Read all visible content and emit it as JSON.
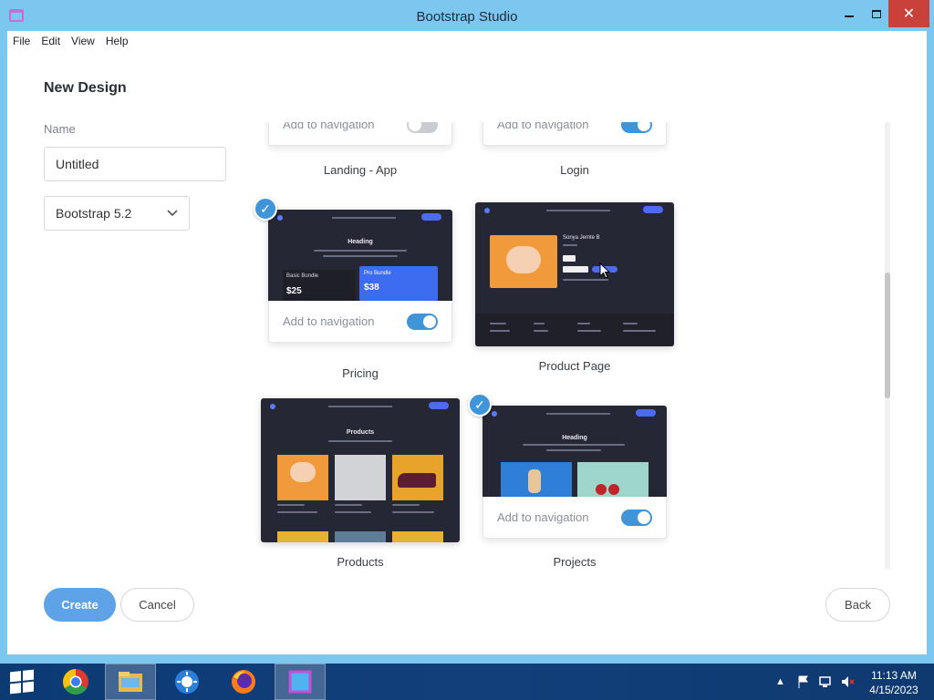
{
  "window": {
    "title": "Bootstrap Studio"
  },
  "menu": [
    "File",
    "Edit",
    "View",
    "Help"
  ],
  "dialog": {
    "title": "New Design",
    "name_label": "Name",
    "name_value": "Untitled",
    "bootstrap_version": "Bootstrap 5.2"
  },
  "templates": [
    {
      "name": "Landing - App",
      "nav_label": "Add to navigation",
      "add_to_nav": false,
      "selected": false
    },
    {
      "name": "Login",
      "nav_label": "Add to navigation",
      "add_to_nav": true,
      "selected": false
    },
    {
      "name": "Pricing",
      "nav_label": "Add to navigation",
      "add_to_nav": true,
      "selected": true,
      "preview": {
        "heading": "Heading",
        "basic_title": "Basic Bundle",
        "basic_price": "$25",
        "pro_title": "Pro Bundle",
        "pro_price": "$38"
      }
    },
    {
      "name": "Product Page",
      "selected": false,
      "preview": {
        "product_title": "Sonya Jemte B"
      }
    },
    {
      "name": "Products",
      "selected": false,
      "preview": {
        "heading": "Products"
      }
    },
    {
      "name": "Projects",
      "nav_label": "Add to navigation",
      "add_to_nav": true,
      "selected": true,
      "preview": {
        "heading": "Heading"
      }
    }
  ],
  "buttons": {
    "create": "Create",
    "cancel": "Cancel",
    "back": "Back"
  },
  "taskbar": {
    "apps": [
      "chrome-icon",
      "file-explorer-icon",
      "control-panel-icon",
      "firefox-icon",
      "bootstrap-studio-icon"
    ],
    "time": "11:13 AM",
    "date": "4/15/2023"
  },
  "colors": {
    "accent": "#3f95d8",
    "create_button": "#5ea2e8",
    "titlebar": "#7cc7f0",
    "close": "#c9413a"
  }
}
